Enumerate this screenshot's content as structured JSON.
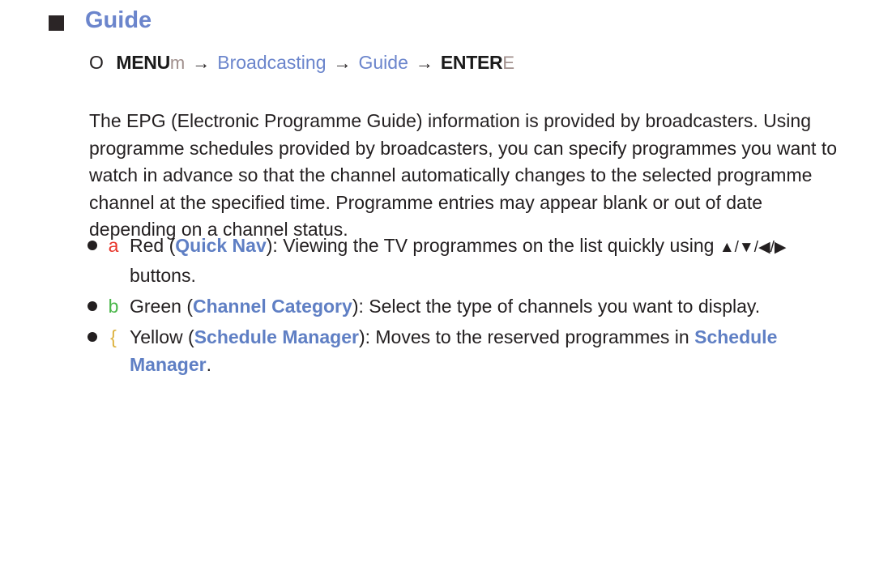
{
  "heading": {
    "marker": "square-bullet",
    "title": "Guide"
  },
  "menu_path": {
    "circle_glyph": "O",
    "menu_label": "MENU",
    "menu_key": "m",
    "arrow": "→",
    "step1": "Broadcasting",
    "step2": "Guide",
    "enter_label": "ENTER",
    "enter_key": "E"
  },
  "paragraph": {
    "text": "The EPG (Electronic Programme Guide) information is provided by broadcasters. Using programme schedules provided by broadcasters, you can specify programmes you want to watch in advance so that the channel automatically changes to the selected programme channel at the specified time. Programme entries may appear blank or out of date depending on a channel status."
  },
  "bullets": [
    {
      "key": "a",
      "key_color": "#e8352a",
      "key_name": "red-button-key",
      "prefix": "Red (",
      "term": "Quick Nav",
      "middle": "): Viewing the TV programmes on the list quickly using ",
      "arrows": "▲/▼/◀/▶",
      "suffix": " buttons."
    },
    {
      "key": "b",
      "key_color": "#49b649",
      "key_name": "green-button-key",
      "prefix": "Green (",
      "term": "Channel Category",
      "middle": "): Select the type of channels you want to display.",
      "arrows": "",
      "suffix": ""
    },
    {
      "key": "{",
      "key_color": "#dcb13c",
      "key_name": "yellow-button-key",
      "prefix": "Yellow (",
      "term": "Schedule Manager",
      "middle": "): Moves to the reserved programmes in ",
      "term2": "Schedule Manager",
      "arrows": "",
      "suffix": "."
    }
  ],
  "colors": {
    "accent_blue": "#6b85cc",
    "term_blue": "#5f7fc4",
    "body_text": "#231f20",
    "red": "#e8352a",
    "green": "#49b649",
    "yellow": "#dcb13c",
    "marker_dark": "#2b2526"
  }
}
